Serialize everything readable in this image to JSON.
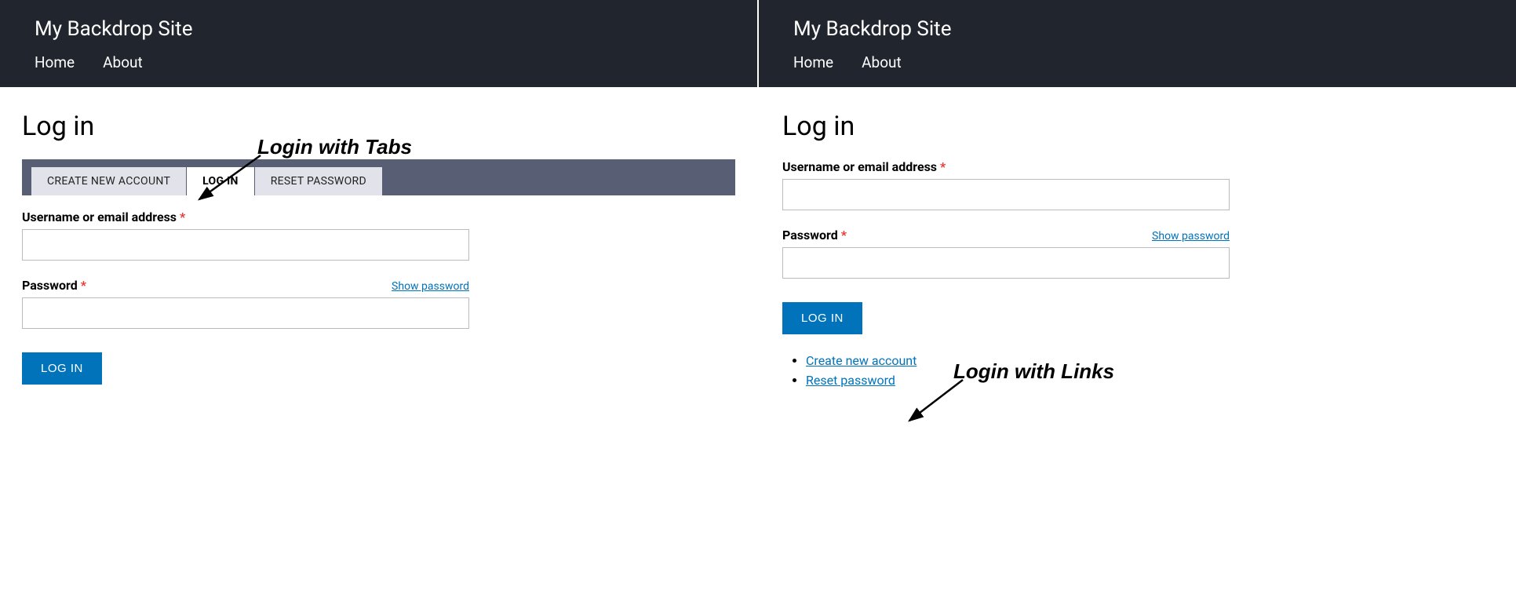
{
  "site_title": "My Backdrop Site",
  "nav": {
    "home": "Home",
    "about": "About"
  },
  "page_title": "Log in",
  "tabs": {
    "create": "CREATE NEW ACCOUNT",
    "login": "LOG IN",
    "reset": "RESET PASSWORD"
  },
  "fields": {
    "username_label": "Username or email address",
    "password_label": "Password",
    "required_marker": "*",
    "show_password": "Show password"
  },
  "submit_label": "LOG IN",
  "links": {
    "create_account": "Create new account",
    "reset_password": "Reset password"
  },
  "annotations": {
    "tabs": "Login with Tabs",
    "links": "Login with Links"
  }
}
